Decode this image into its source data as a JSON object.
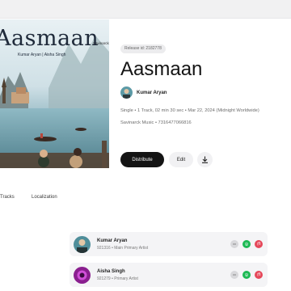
{
  "cover": {
    "label": "Savinarck",
    "title": "Aasmaan",
    "subtitle": "Kumar Aryan | Aisha Singh"
  },
  "release": {
    "pill": "Release id: 2182778",
    "title": "Aasmaan",
    "artist": "Kumar Aryan",
    "meta_line1": "Single  •  1 Track, 02 min 30 sec  •  Mar 22, 2024 (Midnight Worldwide)",
    "meta_line2": "Savinarck Music  •  7316477066816"
  },
  "actions": {
    "distribute": "Distribute",
    "edit": "Edit"
  },
  "tabs": [
    "Tracks",
    "Localization"
  ],
  "contributors": [
    {
      "name": "Kumar Aryan",
      "sub": "921316 • Main Primary Artist"
    },
    {
      "name": "Aisha Singh",
      "sub": "921279 • Primary Artist"
    }
  ],
  "colors": {
    "spotify_green": "#1db954",
    "apple_red": "#e5485a",
    "primary_dark": "#141414"
  },
  "icons": [
    "download-icon",
    "link-icon",
    "spotify-icon",
    "apple-music-icon"
  ]
}
